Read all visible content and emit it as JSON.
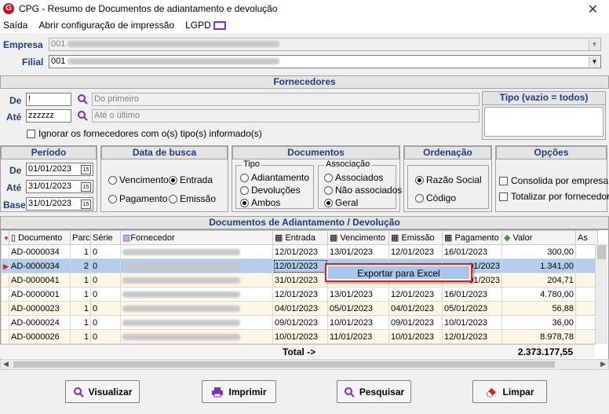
{
  "window": {
    "logo_letter": "G",
    "title": "CPG - Resumo de Documentos de adiantamento e devolução",
    "close": "✕"
  },
  "menu": {
    "items": [
      "Saída",
      "Abrir configuração de impressão",
      "LGPD"
    ]
  },
  "header": {
    "empresa_label": "Empresa",
    "empresa_code": "001",
    "filial_label": "Filial",
    "filial_code": "001"
  },
  "fornecedores": {
    "title": "Fornecedores",
    "de_label": "De",
    "de_value": "!",
    "de_desc": "Do primeiro",
    "ate_label": "Até",
    "ate_value": "zzzzzz",
    "ate_desc": "Até o último",
    "ignore_label": "Ignorar os fornecedores com o(s) tipo(s) informado(s)",
    "tipo_title": "Tipo (vazio = todos)"
  },
  "periodo": {
    "title": "Período",
    "de_label": "De",
    "de_value": "01/01/2023",
    "ate_label": "Até",
    "ate_value": "31/01/2023",
    "base_label": "Base",
    "base_value": "31/01/2023",
    "cal": "15"
  },
  "data_busca": {
    "title": "Data de busca",
    "options": [
      "Vencimento",
      "Entrada",
      "Pagamento",
      "Emissão"
    ],
    "selected": "Entrada"
  },
  "documentos": {
    "title": "Documentos",
    "tipo_label": "Tipo",
    "tipo_options": [
      "Adiantamento",
      "Devoluções",
      "Ambos"
    ],
    "tipo_selected": "Ambos",
    "assoc_label": "Associação",
    "assoc_options": [
      "Associados",
      "Não associados",
      "Geral"
    ],
    "assoc_selected": "Geral"
  },
  "ordenacao": {
    "title": "Ordenação",
    "options": [
      "Razão Social",
      "Código"
    ],
    "selected": "Razão Social"
  },
  "opcoes": {
    "title": "Opções",
    "options": [
      "Consolida por empresa",
      "Totalizar por fornecedor"
    ]
  },
  "grid": {
    "title": "Documentos de Adiantamento / Devolução",
    "columns": [
      "Documento",
      "Parc",
      "Série",
      "Fornecedor",
      "Entrada",
      "Vencimento",
      "Emissão",
      "Pagamento",
      "Valor",
      "As"
    ],
    "rows": [
      {
        "documento": "AD-0000034",
        "parc": "1",
        "serie": "0",
        "entrada": "12/01/2023",
        "vencimento": "13/01/2023",
        "emissao": "12/01/2023",
        "pagamento": "16/01/2023",
        "valor": "300,00"
      },
      {
        "documento": "AD-0000034",
        "parc": "2",
        "serie": "0",
        "entrada": "12/01/2023",
        "vencimento": "",
        "emissao": "",
        "pagamento": "01/2023",
        "valor": "1.341,00"
      },
      {
        "documento": "AD-0000041",
        "parc": "1",
        "serie": "0",
        "entrada": "31/01/2023",
        "vencimento": "",
        "emissao": "",
        "pagamento": "01/2023",
        "valor": "204,71"
      },
      {
        "documento": "AD-0000001",
        "parc": "1",
        "serie": "0",
        "entrada": "12/01/2023",
        "vencimento": "13/01/2023",
        "emissao": "12/01/2023",
        "pagamento": "16/01/2023",
        "valor": "4.780,00"
      },
      {
        "documento": "AD-0000023",
        "parc": "1",
        "serie": "0",
        "entrada": "04/01/2023",
        "vencimento": "05/01/2023",
        "emissao": "04/01/2023",
        "pagamento": "05/01/2023",
        "valor": "56,88"
      },
      {
        "documento": "AD-0000024",
        "parc": "1",
        "serie": "0",
        "entrada": "09/01/2023",
        "vencimento": "10/01/2023",
        "emissao": "09/01/2023",
        "pagamento": "10/01/2023",
        "valor": "36,00"
      },
      {
        "documento": "AD-0000026",
        "parc": "1",
        "serie": "0",
        "entrada": "10/01/2023",
        "vencimento": "11/01/2023",
        "emissao": "10/01/2023",
        "pagamento": "12/01/2023",
        "valor": "8.978,78"
      }
    ],
    "total_label": "Total ->",
    "total_value": "2.373.177,55"
  },
  "context_menu": {
    "item": "Exportar para Excel"
  },
  "buttons": {
    "visualizar": "Visualizar",
    "imprimir": "Imprimir",
    "pesquisar": "Pesquisar",
    "limpar": "Limpar"
  },
  "colors": {
    "header_text": "#1f3d7a",
    "selection": "#b5cde8",
    "highlight_border": "#d81f2a",
    "accent_purple": "#7b2fbe"
  }
}
